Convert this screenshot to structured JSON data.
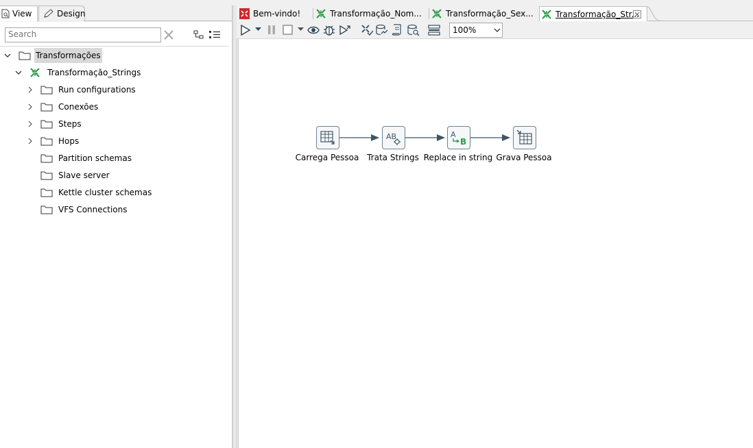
{
  "left_panel": {
    "tabs": {
      "view": "View",
      "design": "Design"
    },
    "search": {
      "placeholder": "Search"
    },
    "tree": {
      "root": "Transformações",
      "transformation": "Transformação_Strings",
      "items": [
        "Run configurations",
        "Conexões",
        "Steps",
        "Hops",
        "Partition schemas",
        "Slave server",
        "Kettle cluster schemas",
        "VFS Connections"
      ]
    }
  },
  "editor": {
    "tabs": [
      {
        "label": "Bem-vindo!",
        "icon": "welcome-icon"
      },
      {
        "label": "Transformação_Nom...",
        "icon": "transformation-icon"
      },
      {
        "label": "Transformação_Sex...",
        "icon": "transformation-icon"
      },
      {
        "label": "Transformação_Str...",
        "icon": "transformation-icon",
        "active": true
      }
    ],
    "toolbar": {
      "zoom": "100%",
      "icons": [
        "run-icon",
        "run-options-icon",
        "pause-icon",
        "stop-icon",
        "stop-options-icon",
        "preview-icon",
        "debug-icon",
        "replay-icon",
        "verify-icon",
        "impact-icon",
        "sql-icon",
        "database-explore-icon",
        "show-results-icon"
      ]
    },
    "canvas": {
      "steps": [
        {
          "label": "Carrega Pessoa",
          "icon": "table-input-icon"
        },
        {
          "label": "Trata Strings",
          "icon": "string-operations-icon"
        },
        {
          "label": "Replace in string",
          "icon": "replace-in-string-icon"
        },
        {
          "label": "Grava Pessoa",
          "icon": "table-output-icon"
        }
      ]
    }
  },
  "colors": {
    "accent_green": "#2e9e4a",
    "welcome_red": "#cc2a2a",
    "hop_arrow": "#3f5566",
    "step_border": "#6e8292"
  }
}
